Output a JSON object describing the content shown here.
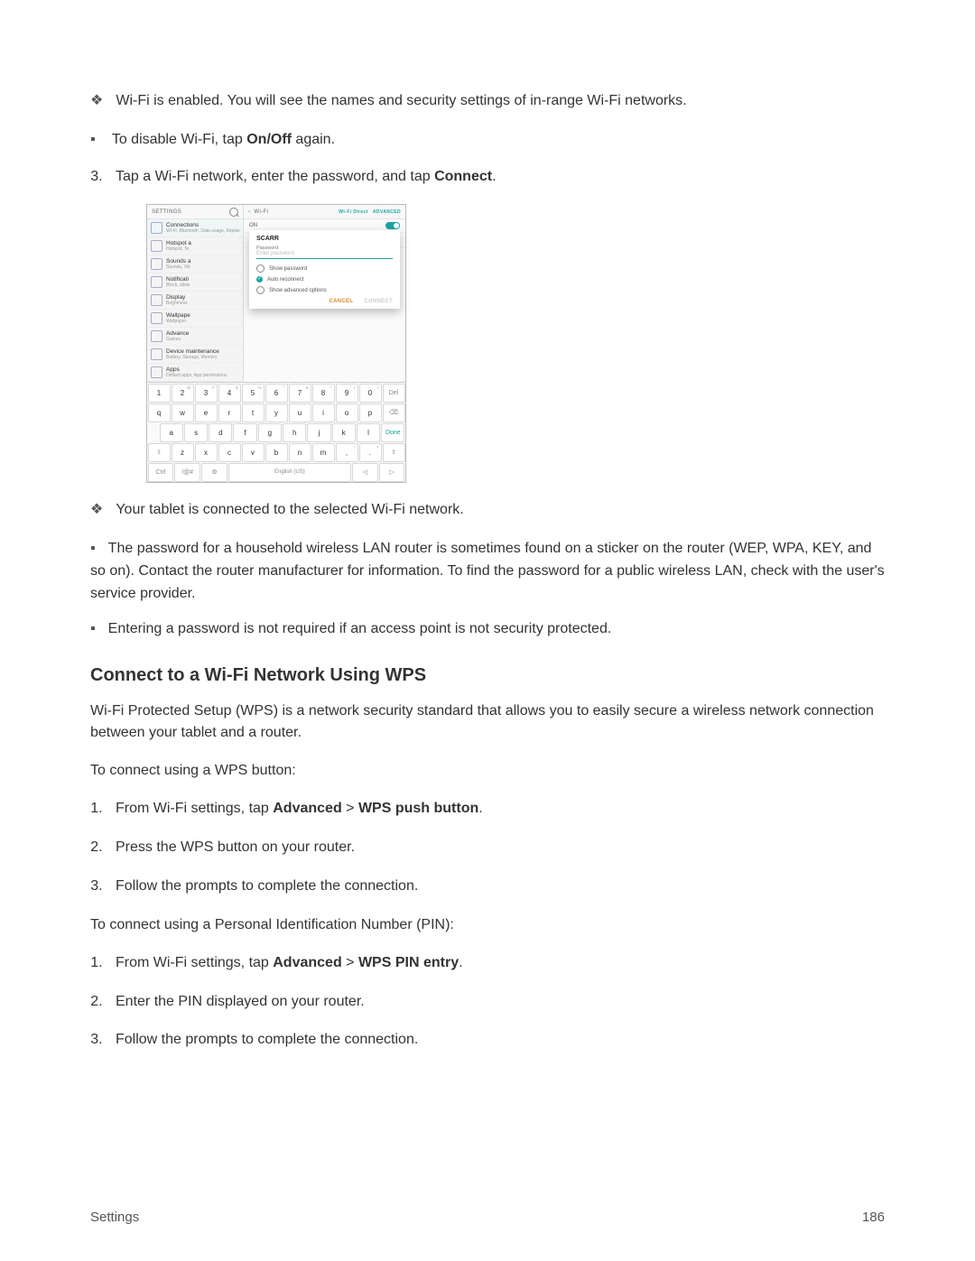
{
  "bullets": {
    "wifi_enabled": "Wi-Fi is enabled. You will see the names and security settings of in-range Wi-Fi networks.",
    "disable_prefix": "To disable Wi-Fi, tap ",
    "disable_bold": "On/Off",
    "disable_suffix": " again.",
    "step3_prefix": "Tap a Wi-Fi network, enter the password, and tap ",
    "step3_bold": "Connect",
    "step3_suffix": ".",
    "connected": "Your tablet is connected to the selected Wi-Fi network.",
    "password_note": "The password for a household wireless LAN router is sometimes found on a sticker on the router (WEP, WPA, KEY, and so on). Contact the router manufacturer for information. To find the password for a public wireless LAN, check with the user's service provider.",
    "no_password": "Entering a password is not required if an access point is not security protected."
  },
  "wps": {
    "heading": "Connect to a Wi-Fi Network Using WPS",
    "intro": "Wi-Fi Protected Setup (WPS) is a network security standard that allows you to easily secure a wireless network connection between your tablet and a router.",
    "btn_lead": "To connect using a WPS button:",
    "btn_steps": {
      "s1_pre": "From Wi-Fi settings, tap ",
      "s1_b1": "Advanced",
      "s1_mid": " > ",
      "s1_b2": "WPS push button",
      "s1_post": ".",
      "s2": "Press the WPS button on your router.",
      "s3": "Follow the prompts to complete the connection."
    },
    "pin_lead": "To connect using a Personal Identification Number (PIN):",
    "pin_steps": {
      "s1_pre": "From Wi-Fi settings, tap ",
      "s1_b1": "Advanced",
      "s1_mid": " > ",
      "s1_b2": "WPS PIN entry",
      "s1_post": ".",
      "s2": "Enter the PIN displayed on your router.",
      "s3": "Follow the prompts to complete the connection."
    }
  },
  "footer": {
    "left": "Settings",
    "right": "186"
  },
  "screenshot": {
    "settings_header": "SETTINGS",
    "wifi_header": "Wi-Fi",
    "wifi_direct": "Wi-Fi Direct",
    "advanced": "ADVANCED",
    "on_label": "ON",
    "network_name": "SCARR",
    "settings_items": [
      {
        "t": "Connections",
        "s": "Wi-Fi, Bluetooth, Data usage, Airplane m..."
      },
      {
        "t": "Hotspot a",
        "s": "Hotspot, Te"
      },
      {
        "t": "Sounds a",
        "s": "Sounds, Vib"
      },
      {
        "t": "Notificati",
        "s": "Block, allow"
      },
      {
        "t": "Display",
        "s": "Brightness"
      },
      {
        "t": "Wallpape",
        "s": "Wallpaper"
      },
      {
        "t": "Advance",
        "s": "Games"
      },
      {
        "t": "Device maintenance",
        "s": "Battery, Storage, Memory"
      },
      {
        "t": "Apps",
        "s": "Default apps, App permissions"
      }
    ],
    "dialog": {
      "title": "SCARR",
      "password_label": "Password",
      "password_placeholder": "Enter password",
      "show_password": "Show password",
      "auto_reconnect": "Auto reconnect",
      "show_advanced": "Show advanced options",
      "cancel": "CANCEL",
      "connect": "CONNECT"
    },
    "keyboard": {
      "row1": [
        {
          "k": "1",
          "s": ""
        },
        {
          "k": "2",
          "s": "@"
        },
        {
          "k": "3",
          "s": "#"
        },
        {
          "k": "4",
          "s": "$"
        },
        {
          "k": "5",
          "s": "%"
        },
        {
          "k": "6",
          "s": "^"
        },
        {
          "k": "7",
          "s": "&"
        },
        {
          "k": "8",
          "s": "*"
        },
        {
          "k": "9",
          "s": "("
        },
        {
          "k": "0",
          "s": ")"
        },
        {
          "k": "Del",
          "s": ""
        }
      ],
      "row2": [
        {
          "k": "q",
          "s": ""
        },
        {
          "k": "w",
          "s": ""
        },
        {
          "k": "e",
          "s": ""
        },
        {
          "k": "r",
          "s": ""
        },
        {
          "k": "t",
          "s": ""
        },
        {
          "k": "y",
          "s": ""
        },
        {
          "k": "u",
          "s": ""
        },
        {
          "k": "i",
          "s": ""
        },
        {
          "k": "o",
          "s": ""
        },
        {
          "k": "p",
          "s": ""
        },
        {
          "k": "⌫",
          "s": ""
        }
      ],
      "row3": [
        {
          "k": "a",
          "s": ""
        },
        {
          "k": "s",
          "s": ""
        },
        {
          "k": "d",
          "s": ""
        },
        {
          "k": "f",
          "s": ""
        },
        {
          "k": "g",
          "s": ""
        },
        {
          "k": "h",
          "s": ""
        },
        {
          "k": "j",
          "s": ""
        },
        {
          "k": "k",
          "s": ""
        },
        {
          "k": "l",
          "s": ""
        },
        {
          "k": "Done",
          "s": ""
        }
      ],
      "row4": [
        {
          "k": "⇧",
          "s": ""
        },
        {
          "k": "z",
          "s": ""
        },
        {
          "k": "x",
          "s": ""
        },
        {
          "k": "c",
          "s": ""
        },
        {
          "k": "v",
          "s": ""
        },
        {
          "k": "b",
          "s": ""
        },
        {
          "k": "n",
          "s": ""
        },
        {
          "k": "m",
          "s": ""
        },
        {
          "k": ",",
          "s": "!"
        },
        {
          "k": ".",
          "s": "?"
        },
        {
          "k": "⇧",
          "s": ""
        }
      ],
      "row5": {
        "ctrl": "Ctrl",
        "sym": "!@#",
        "gear": "⚙",
        "space": "English (US)",
        "left": "◁",
        "right": "▷"
      }
    }
  }
}
